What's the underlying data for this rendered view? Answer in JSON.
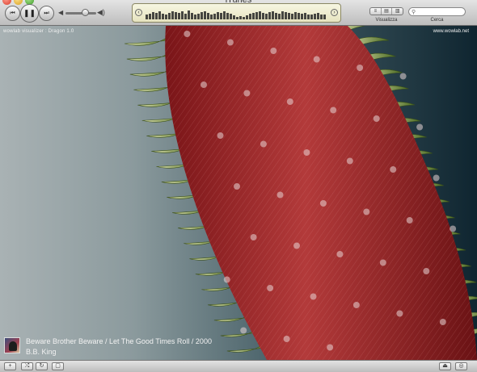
{
  "window": {
    "title": "iTunes"
  },
  "controls": {
    "prev_icon": "⏮",
    "pause_icon": "❚❚",
    "next_icon": "⏭",
    "volume_low_icon": "◀",
    "volume_high_icon": "◀)",
    "volume_level": 0.62
  },
  "lcd": {
    "left_button_icon": "circle-back",
    "right_button_icon": "circle-forward",
    "eq_levels": [
      0.35,
      0.45,
      0.55,
      0.5,
      0.6,
      0.45,
      0.4,
      0.5,
      0.65,
      0.55,
      0.5,
      0.6,
      0.45,
      0.7,
      0.5,
      0.35,
      0.45,
      0.55,
      0.6,
      0.5,
      0.4,
      0.45,
      0.55,
      0.5,
      0.6,
      0.5,
      0.45,
      0.3,
      0.2,
      0.25,
      0.2,
      0.3,
      0.45,
      0.5,
      0.55,
      0.6,
      0.5,
      0.45,
      0.55,
      0.65,
      0.5,
      0.45,
      0.6,
      0.55,
      0.5,
      0.45,
      0.55,
      0.5,
      0.45,
      0.5,
      0.4,
      0.35,
      0.45,
      0.5,
      0.4,
      0.35
    ]
  },
  "toolbar": {
    "view_label": "Visualizza",
    "view_icons": [
      "list-view-icon",
      "album-view-icon",
      "coverflow-view-icon"
    ],
    "search_label": "Cerca",
    "search_placeholder": "",
    "search_value": ""
  },
  "visualizer": {
    "name": "wowlab visualizer : Dragon 1.0",
    "site": "www.wowlab.net"
  },
  "now_playing": {
    "title": "Beware Brother Beware / Let The Good Times Roll / 2000",
    "artist": "B.B. King"
  },
  "bottom_bar": {
    "add_icon": "+",
    "shuffle_icon": "⤮",
    "repeat_icon": "↻",
    "artwork_icon": "▢",
    "eject_icon": "⏏",
    "burn_icon": "◎"
  },
  "colors": {
    "fur": "#8a1e22",
    "fin": "#6f8a3a",
    "background_left": "#a9b2b4",
    "background_right": "#0f2530"
  }
}
